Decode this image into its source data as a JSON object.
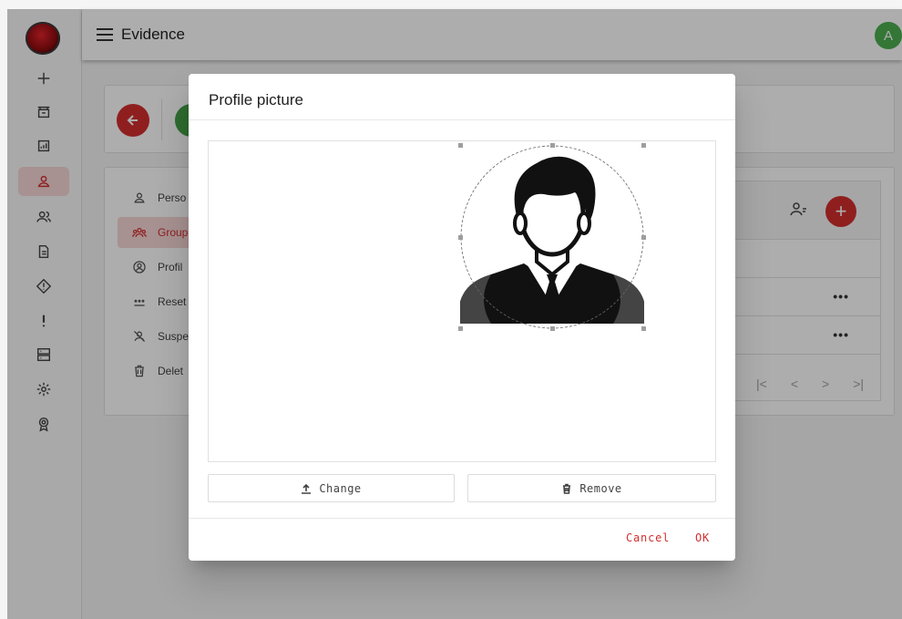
{
  "app": {
    "title": "Evidence",
    "avatar_letter": "A",
    "colors": {
      "accent": "#d32f2f",
      "avatar": "#4caf50",
      "active_bg": "#f6d6d6"
    }
  },
  "rail": {
    "icons": [
      "plus-icon",
      "archive-icon",
      "report-icon",
      "user-icon",
      "users-icon",
      "document-icon",
      "warning-diamond-icon",
      "exclamation-icon",
      "server-icon",
      "settings-icon",
      "badge-icon"
    ],
    "active_index": 3
  },
  "side_menu": {
    "items": [
      {
        "label": "Perso",
        "icon": "person-icon"
      },
      {
        "label": "Group",
        "icon": "group-icon",
        "active": true
      },
      {
        "label": "Profil",
        "icon": "profile-circle-icon"
      },
      {
        "label": "Reset",
        "icon": "password-dots-icon"
      },
      {
        "label": "Suspe",
        "icon": "user-off-icon"
      },
      {
        "label": "Delet",
        "icon": "trash-icon"
      }
    ]
  },
  "table": {
    "row_action": "•••",
    "pager": [
      "|<",
      "<",
      ">",
      ">|"
    ]
  },
  "dialog": {
    "title": "Profile picture",
    "change_label": "Change",
    "remove_label": "Remove",
    "cancel_label": "Cancel",
    "ok_label": "OK"
  }
}
